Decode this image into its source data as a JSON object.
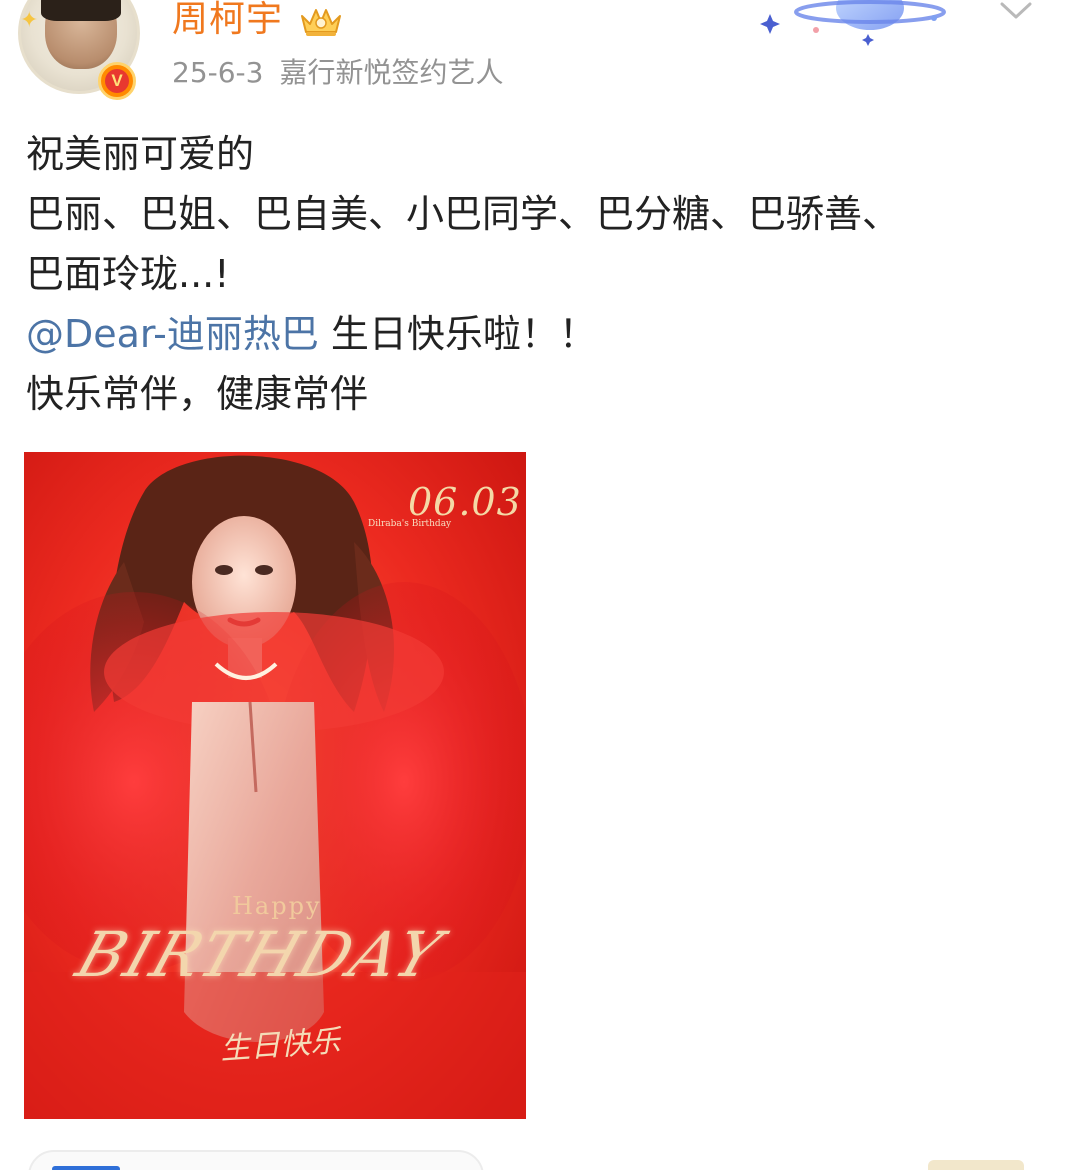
{
  "header": {
    "username": "周柯宇",
    "post_date": "25-6-3",
    "user_description": "嘉行新悦签约艺人",
    "verified_badge_label": "V"
  },
  "post": {
    "lines": [
      "祝美丽可爱的",
      "巴丽、巴姐、巴自美、小巴同学、巴分糖、巴骄善、",
      "巴面玲珑...!"
    ],
    "mention": "@Dear-迪丽热巴",
    "mention_suffix": " 生日快乐啦！！",
    "closing": "快乐常伴，健康常伴"
  },
  "image": {
    "date_text": "06.03",
    "caption": "Dilraba's Birthday",
    "happy": "Happy",
    "birthday": "BIRTHDAY",
    "script": "生日快乐"
  },
  "colors": {
    "username": "#f0781e",
    "meta": "#939393",
    "text": "#222222",
    "mention": "#4c74a6",
    "image_bg": "#e8261e"
  },
  "icons": {
    "crown": "crown-icon",
    "planet": "planet-decoration-icon",
    "chevron": "chevron-down-icon",
    "verified": "verified-v-icon"
  }
}
